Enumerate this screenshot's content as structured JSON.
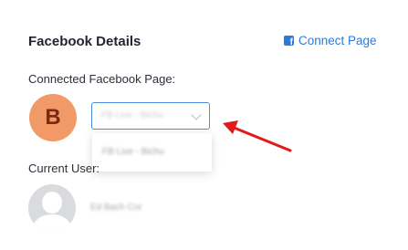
{
  "header": {
    "title": "Facebook Details",
    "connect_link_label": "Connect Page"
  },
  "page_section": {
    "label": "Connected Facebook Page:",
    "avatar_letter": "B",
    "avatar_color": "#f29a67",
    "selected_page": "FB Live - Bichu",
    "dropdown_options": [
      "FB Live - Bichu"
    ]
  },
  "user_section": {
    "label": "Current User:",
    "user_name": "Ed Bach Cor"
  },
  "colors": {
    "accent": "#2a7bd9",
    "arrow": "#e3191b"
  }
}
